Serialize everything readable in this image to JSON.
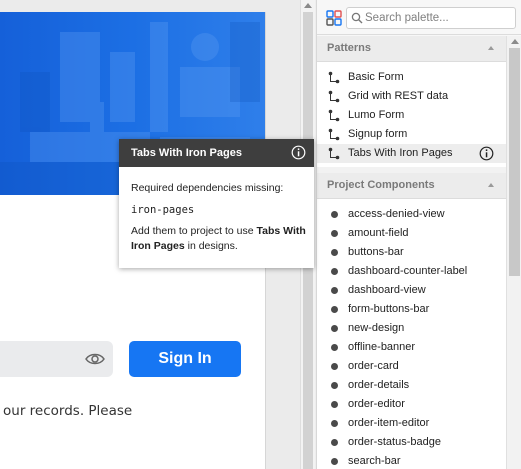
{
  "canvas": {
    "signin_label": "Sign In",
    "records_text": "our records. Please"
  },
  "palette": {
    "search_placeholder": "Search palette...",
    "sections": {
      "patterns": {
        "title": "Patterns",
        "items": [
          "Basic Form",
          "Grid with REST data",
          "Lumo Form",
          "Signup form",
          "Tabs With Iron Pages"
        ]
      },
      "components": {
        "title": "Project Components",
        "items": [
          "access-denied-view",
          "amount-field",
          "buttons-bar",
          "dashboard-counter-label",
          "dashboard-view",
          "form-buttons-bar",
          "new-design",
          "offline-banner",
          "order-card",
          "order-details",
          "order-editor",
          "order-item-editor",
          "order-status-badge",
          "search-bar"
        ]
      }
    }
  },
  "tooltip": {
    "title": "Tabs With Iron Pages",
    "line1": "Required dependencies missing:",
    "code": "iron-pages",
    "text_prefix": "Add them to project to use ",
    "text_bold": "Tabs With Iron Pages",
    "text_suffix": " in designs."
  },
  "colors": {
    "primary_button": "#1676f3",
    "hero_blue": "#1a6be0",
    "tooltip_header": "#3e3e3e"
  },
  "icons": {
    "palette_icon": "palette-grid-icon",
    "search": "search-icon",
    "pattern": "pattern-tree-icon",
    "info": "info-icon",
    "eye": "eye-icon",
    "component": "bullet-dot-icon"
  }
}
